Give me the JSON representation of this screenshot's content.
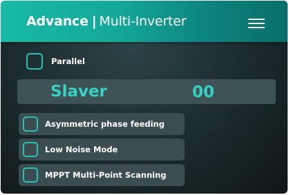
{
  "header": {
    "title_bold": "Advance",
    "separator": "|",
    "title_light": "Multi-Inverter",
    "menu_icon": "hamburger-menu-icon"
  },
  "parallel": {
    "label": "Parallel",
    "checked": false
  },
  "role": {
    "label": "Slaver",
    "value": "00"
  },
  "options": [
    {
      "label": "Asymmetric phase feeding",
      "checked": false
    },
    {
      "label": "Low Noise Mode",
      "checked": false
    },
    {
      "label": "MPPT Multi-Point Scanning",
      "checked": false
    }
  ],
  "colors": {
    "accent": "#27c4b6",
    "header_gradient_start": "#19b9a7",
    "header_gradient_end": "#0a6d69",
    "background": "#1b2a2d",
    "option_background": "#3b4d50"
  }
}
